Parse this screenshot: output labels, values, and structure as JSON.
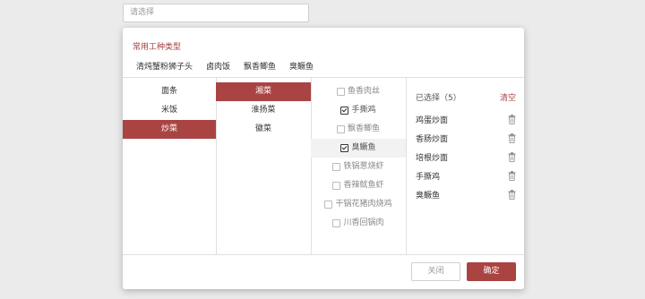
{
  "search": {
    "placeholder": "请选择"
  },
  "common": {
    "title": "常用工种类型",
    "items": [
      "清炖蟹粉狮子头",
      "卤肉饭",
      "飘香鲫鱼",
      "臭鳜鱼"
    ]
  },
  "col1": {
    "items": [
      "面条",
      "米饭",
      "炒菜"
    ],
    "active_index": 2
  },
  "col2": {
    "items": [
      "湘菜",
      "淮扬菜",
      "徽菜"
    ],
    "active_index": 0
  },
  "col3": {
    "items": [
      {
        "label": "鱼香肉丝",
        "checked": false
      },
      {
        "label": "手撕鸡",
        "checked": true
      },
      {
        "label": "飘香鲫鱼",
        "checked": false
      },
      {
        "label": "臭鳜鱼",
        "checked": true
      },
      {
        "label": "铁锅葱烧虾",
        "checked": false
      },
      {
        "label": "香辣鱿鱼虾",
        "checked": false
      },
      {
        "label": "干锅花猪肉烧鸡",
        "checked": false
      },
      {
        "label": "川香回锅肉",
        "checked": false
      }
    ]
  },
  "selected": {
    "header": "已选择（5）",
    "clear_label": "清空",
    "items": [
      "鸡蛋炒面",
      "香肠炒面",
      "培根炒面",
      "手撕鸡",
      "臭鳜鱼"
    ]
  },
  "footer": {
    "close_label": "关闭",
    "ok_label": "确定"
  },
  "colors": {
    "accent": "#a94442"
  }
}
